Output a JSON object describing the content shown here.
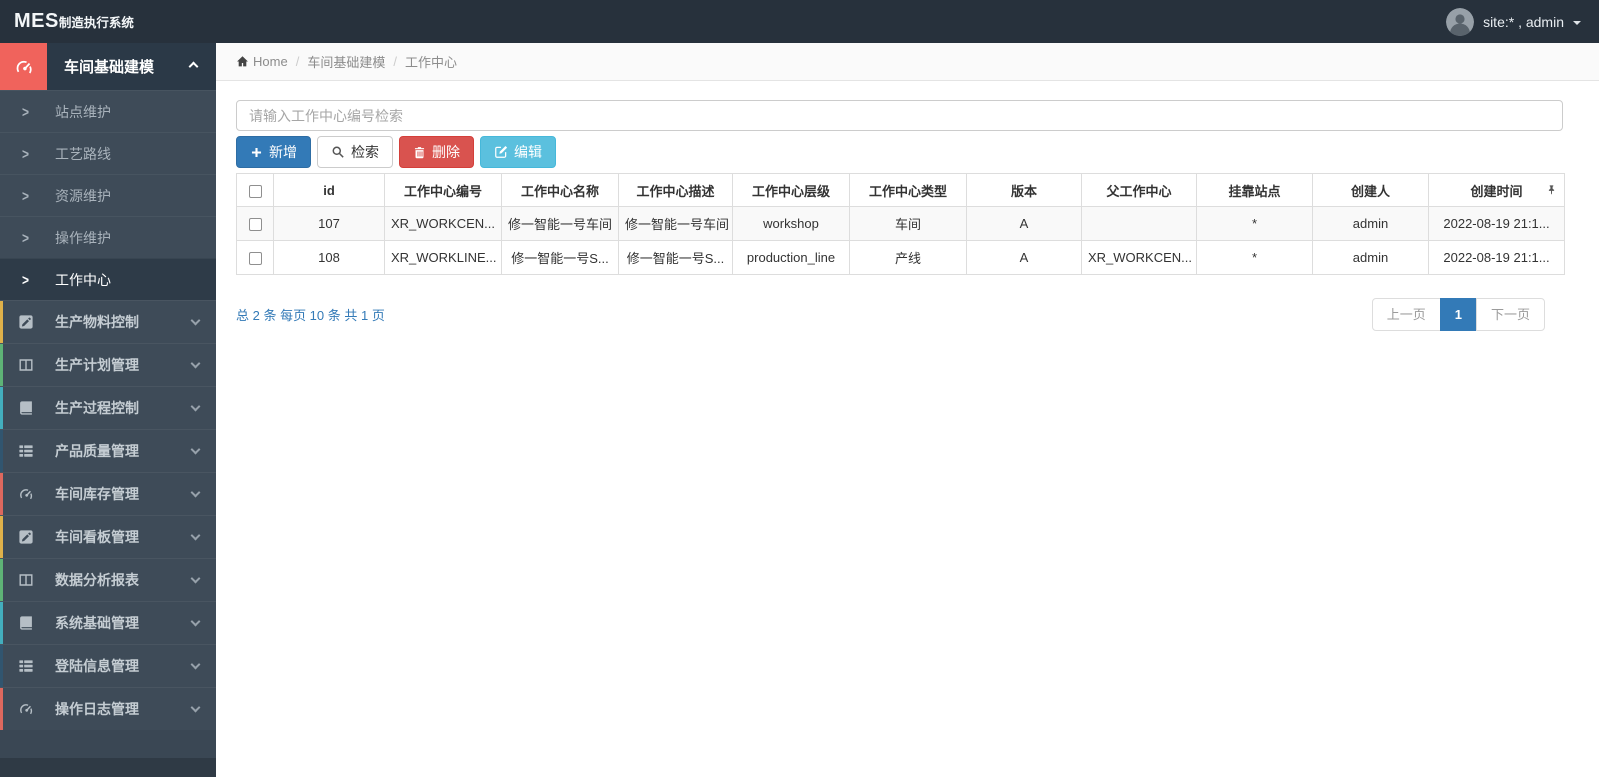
{
  "topbar": {
    "brand_bold": "MES",
    "brand_rest": "制造执行系统",
    "user_label": "site:* , admin"
  },
  "sidebar": {
    "expanded_group": {
      "label": "车间基础建模",
      "icon": "gauge",
      "icon_bg": "#f0635c"
    },
    "submenu": [
      {
        "label": "站点维护",
        "active": false
      },
      {
        "label": "工艺路线",
        "active": false
      },
      {
        "label": "资源维护",
        "active": false
      },
      {
        "label": "操作维护",
        "active": false
      },
      {
        "label": "工作中心",
        "active": true
      }
    ],
    "groups": [
      {
        "label": "生产物料控制",
        "icon": "pen-square",
        "strip": "#dfb14a"
      },
      {
        "label": "生产计划管理",
        "icon": "columns",
        "strip": "#5eb376"
      },
      {
        "label": "生产过程控制",
        "icon": "book",
        "strip": "#43aebd"
      },
      {
        "label": "产品质量管理",
        "icon": "th-list",
        "strip": "#31556f"
      },
      {
        "label": "车间库存管理",
        "icon": "gauge",
        "strip": "#dd685e"
      },
      {
        "label": "车间看板管理",
        "icon": "pen-square",
        "strip": "#dfb14a"
      },
      {
        "label": "数据分析报表",
        "icon": "columns",
        "strip": "#5eb376"
      },
      {
        "label": "系统基础管理",
        "icon": "book",
        "strip": "#43aebd"
      },
      {
        "label": "登陆信息管理",
        "icon": "th-list",
        "strip": "#31556f"
      },
      {
        "label": "操作日志管理",
        "icon": "gauge",
        "strip": "#dd685e"
      }
    ]
  },
  "breadcrumb": {
    "home": "Home",
    "sep": "/",
    "items": [
      "车间基础建模",
      "工作中心"
    ]
  },
  "toolbar": {
    "search_placeholder": "请输入工作中心编号检索",
    "buttons": {
      "add": "新增",
      "search": "检索",
      "delete": "删除",
      "edit": "编辑"
    }
  },
  "table": {
    "columns": [
      "id",
      "工作中心编号",
      "工作中心名称",
      "工作中心描述",
      "工作中心层级",
      "工作中心类型",
      "版本",
      "父工作中心",
      "挂靠站点",
      "创建人",
      "创建时间"
    ],
    "rows": [
      [
        "107",
        "XR_WORKCEN...",
        "修一智能一号车间",
        "修一智能一号车间",
        "workshop",
        "车间",
        "A",
        "",
        "*",
        "admin",
        "2022-08-19 21:1..."
      ],
      [
        "108",
        "XR_WORKLINE...",
        "修一智能一号S...",
        "修一智能一号S...",
        "production_line",
        "产线",
        "A",
        "XR_WORKCEN...",
        "*",
        "admin",
        "2022-08-19 21:1..."
      ]
    ]
  },
  "pagination": {
    "summary": "总 2 条  每页 10 条  共 1 页",
    "prev": "上一页",
    "current": "1",
    "next": "下一页"
  },
  "colors": {
    "primary": "#337ab7",
    "danger": "#d9534f",
    "info": "#5bc0de",
    "sidebar": "#3e4b58",
    "topbar": "#27313c"
  }
}
